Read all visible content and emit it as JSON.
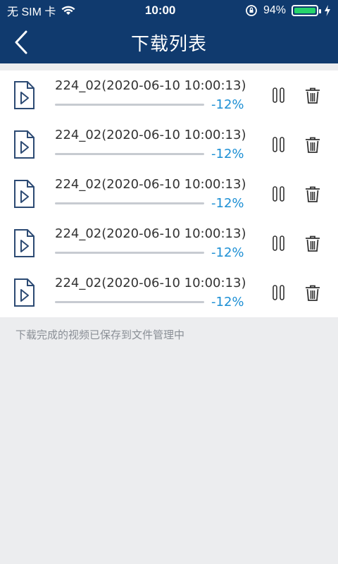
{
  "status_bar": {
    "carrier": "无 SIM 卡",
    "time": "10:00",
    "battery_percent": "94%",
    "icons": [
      "wifi-icon",
      "orientation-lock-icon",
      "battery-icon",
      "charging-bolt-icon"
    ]
  },
  "nav": {
    "title": "下载列表",
    "back_icon": "chevron-left-icon"
  },
  "downloads": [
    {
      "name": "224_02(2020-06-10 10:00:13)",
      "percent": "-12%"
    },
    {
      "name": "224_02(2020-06-10 10:00:13)",
      "percent": "-12%"
    },
    {
      "name": "224_02(2020-06-10 10:00:13)",
      "percent": "-12%"
    },
    {
      "name": "224_02(2020-06-10 10:00:13)",
      "percent": "-12%"
    },
    {
      "name": "224_02(2020-06-10 10:00:13)",
      "percent": "-12%"
    }
  ],
  "footer_note": "下载完成的视频已保存到文件管理中",
  "colors": {
    "header_bg": "#103A6E",
    "percent_text": "#1C8FD4",
    "page_bg": "#ECEDEF",
    "battery_fill": "#26D46B"
  }
}
